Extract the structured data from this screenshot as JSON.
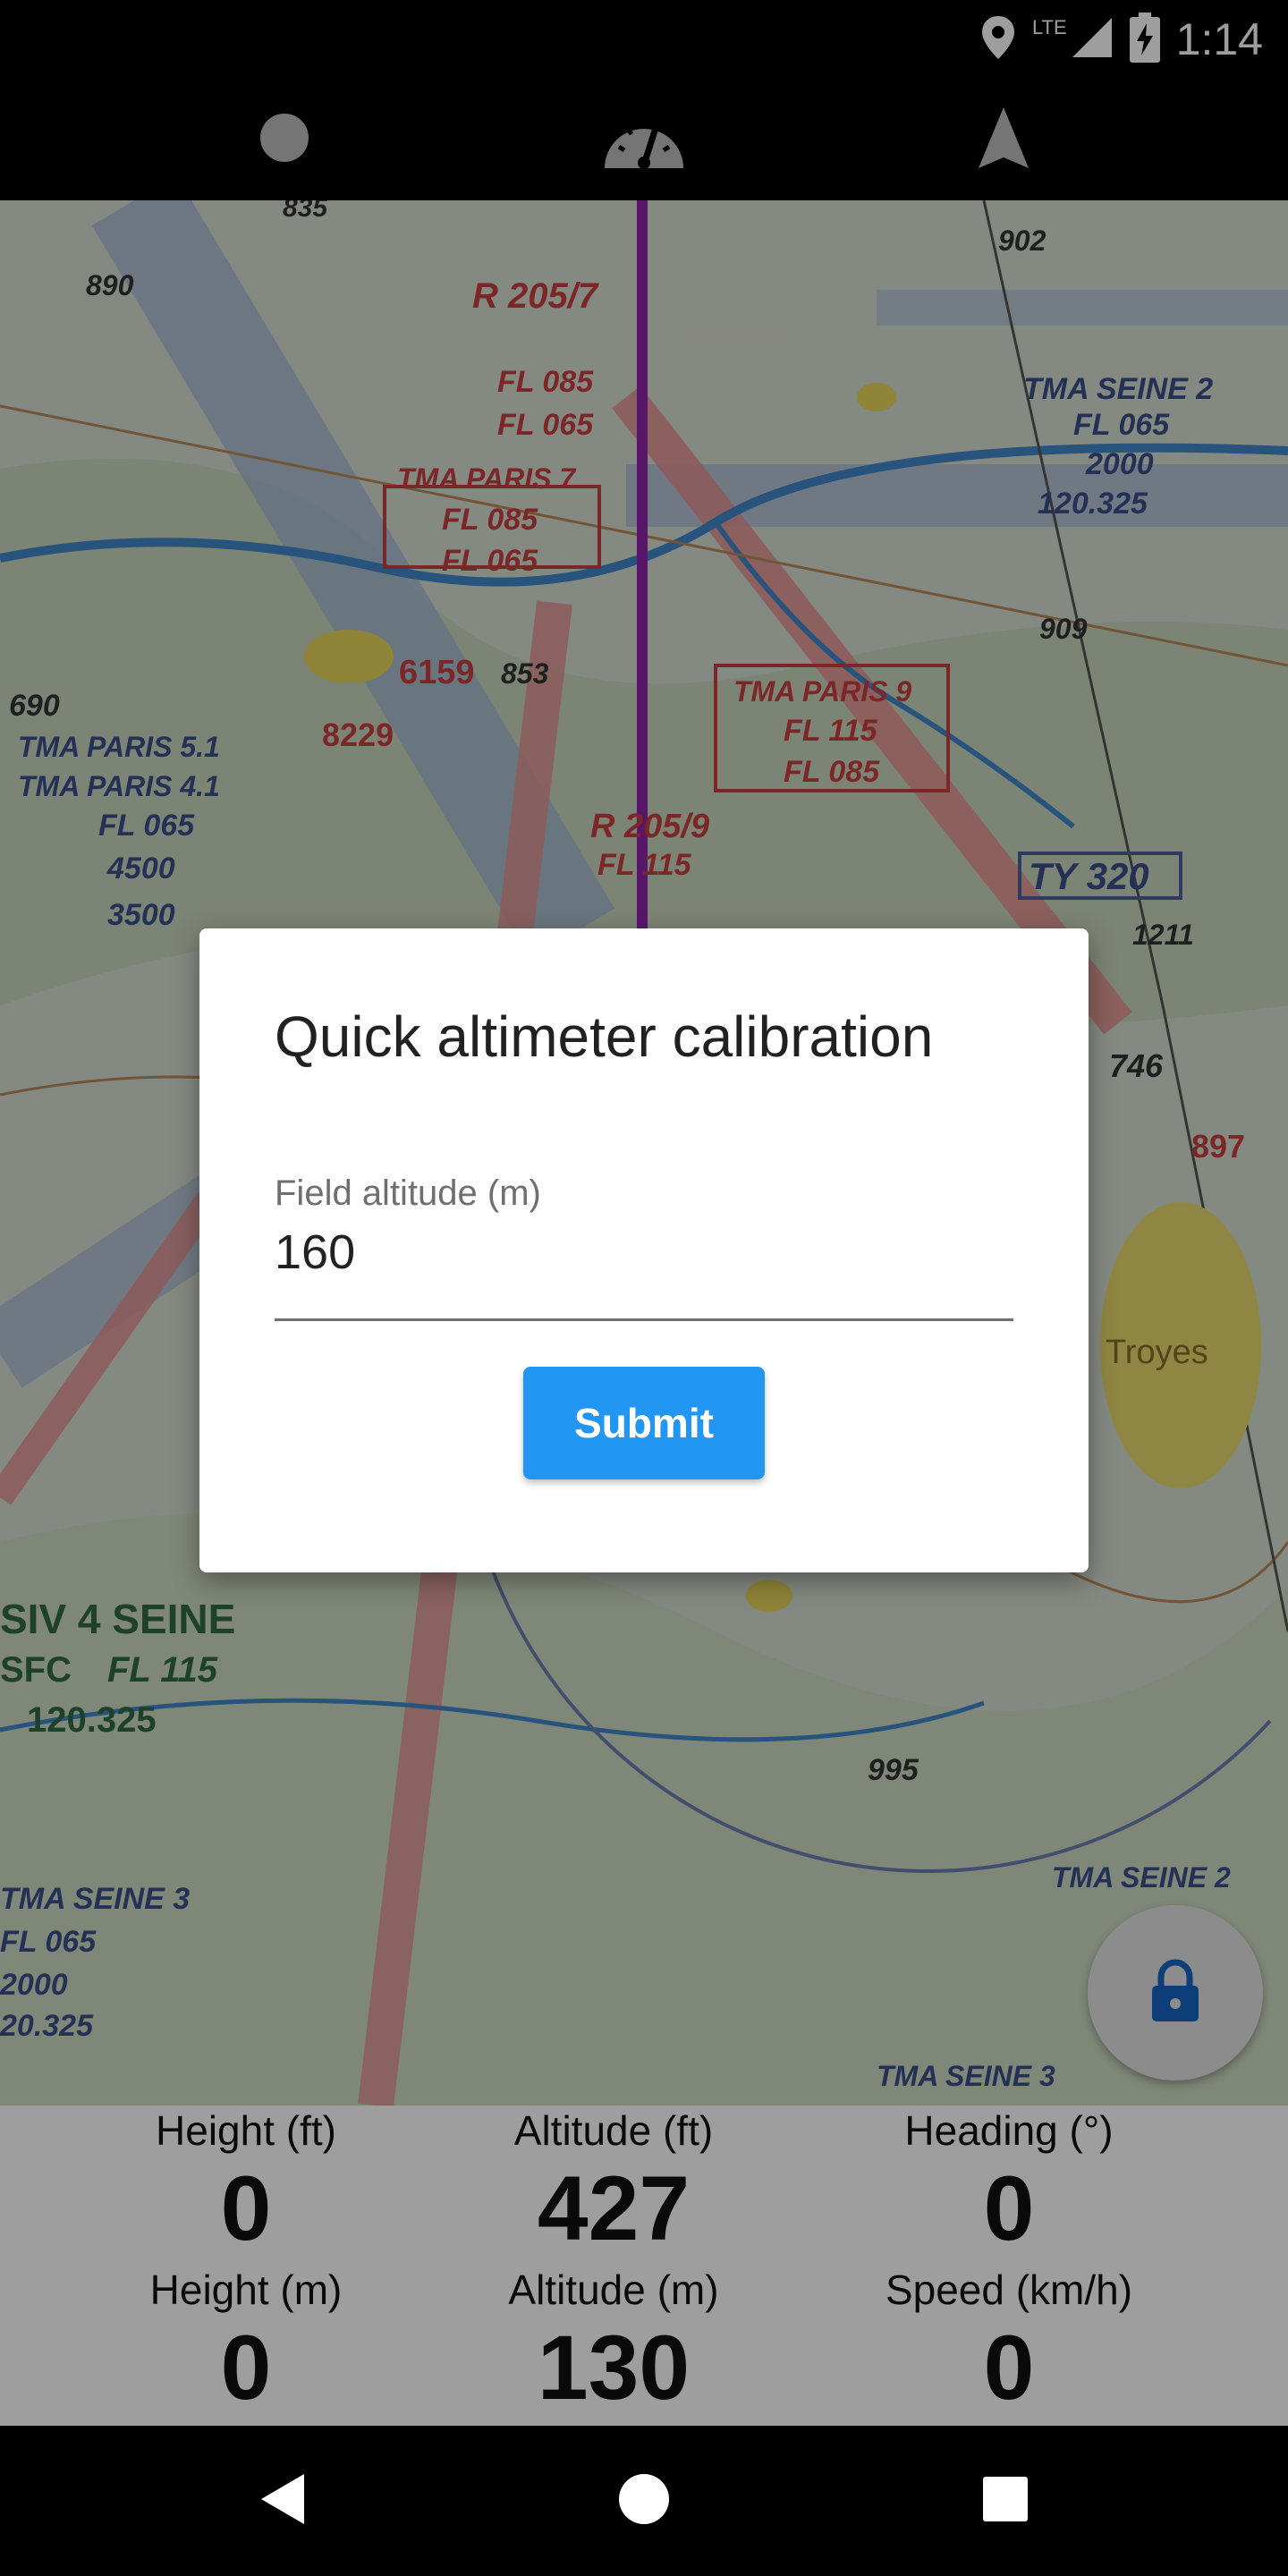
{
  "status_bar": {
    "network": "LTE",
    "time": "1:14",
    "icons": [
      "location-pin-icon",
      "signal-icon",
      "battery-charging-icon"
    ]
  },
  "top_tabs": [
    {
      "icon": "circle-icon"
    },
    {
      "icon": "speedometer-icon"
    },
    {
      "icon": "navigation-arrow-icon"
    }
  ],
  "map": {
    "labels": [
      "R 205/7",
      "FL 085",
      "FL 065",
      "TMA PARIS 7",
      "FL 085",
      "FL 065",
      "TMA SEINE 2",
      "FL 065",
      "2000",
      "120.325",
      "TMA PARIS 9",
      "FL 115",
      "FL 085",
      "R 205/9",
      "FL 115",
      "TY 320",
      "TMA PARIS 5.1",
      "TMA PARIS 4.1",
      "FL 065",
      "4500",
      "3500",
      "SIV 4 SEINE",
      "SFC",
      "FL 115",
      "120.325",
      "TMA SEINE 3",
      "FL 065",
      "2000",
      "20.325",
      "TMA SEINE 2",
      "TMA SEINE 3",
      "Troyes",
      "6159",
      "8229",
      "853",
      "909",
      "746",
      "897",
      "995",
      "690",
      "890",
      "835",
      "902",
      "1211"
    ]
  },
  "dialog": {
    "title": "Quick altimeter calibration",
    "field_label": "Field altitude (m)",
    "field_value": "160",
    "submit_label": "Submit"
  },
  "lock_button": {
    "icon": "lock-icon"
  },
  "telemetry": {
    "height_ft_label": "Height (ft)",
    "height_ft_value": "0",
    "altitude_ft_label": "Altitude (ft)",
    "altitude_ft_value": "427",
    "heading_label": "Heading (°)",
    "heading_value": "0",
    "height_m_label": "Height (m)",
    "height_m_value": "0",
    "altitude_m_label": "Altitude (m)",
    "altitude_m_value": "130",
    "speed_label": "Speed (km/h)",
    "speed_value": "0"
  },
  "nav_bar": [
    "back-icon",
    "home-icon",
    "recents-icon"
  ],
  "colors": {
    "accent": "#2196f3",
    "route_line": "#8e24aa",
    "restricted_zone": "#d84a4a",
    "tma_zone": "#7b95c9"
  }
}
